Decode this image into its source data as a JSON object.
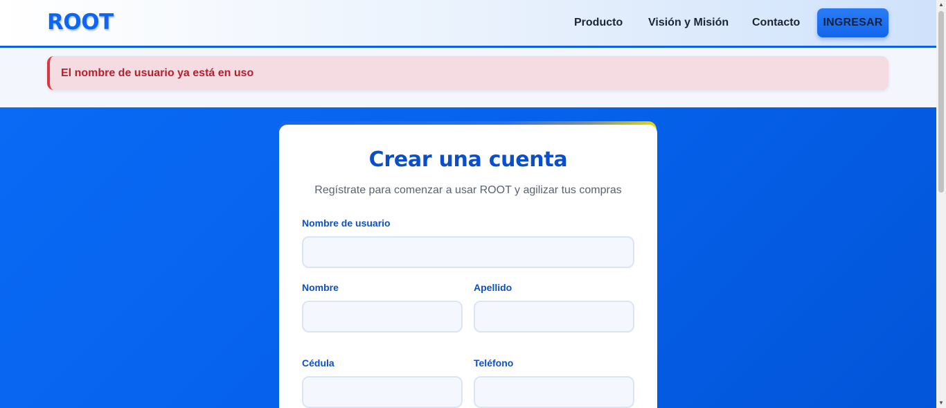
{
  "header": {
    "logo": "ROOT",
    "nav": [
      {
        "label": "Producto"
      },
      {
        "label": "Visión y Misión"
      },
      {
        "label": "Contacto"
      }
    ],
    "login_button": "INGRESAR"
  },
  "alert": {
    "message": "El nombre de usuario ya está en uso"
  },
  "form": {
    "title": "Crear una cuenta",
    "subtitle": "Regístrate para comenzar a usar ROOT y agilizar tus compras",
    "fields": {
      "username": {
        "label": "Nombre de usuario",
        "value": ""
      },
      "first_name": {
        "label": "Nombre",
        "value": ""
      },
      "last_name": {
        "label": "Apellido",
        "value": ""
      },
      "id_number": {
        "label": "Cédula",
        "value": ""
      },
      "phone": {
        "label": "Teléfono",
        "value": ""
      }
    }
  },
  "colors": {
    "brand": "#0d66f2",
    "header_border": "#0b62e0",
    "alert_bg": "#f5dce2",
    "alert_text": "#b4202b",
    "alert_border": "#e0343f",
    "hero_blue": "#0662ec",
    "label_blue": "#0d4fc4",
    "accent_yellow": "#f1d500"
  },
  "icons": {
    "scroll_up": "scroll-up-arrow-icon",
    "scroll_down": "scroll-down-arrow-icon"
  }
}
